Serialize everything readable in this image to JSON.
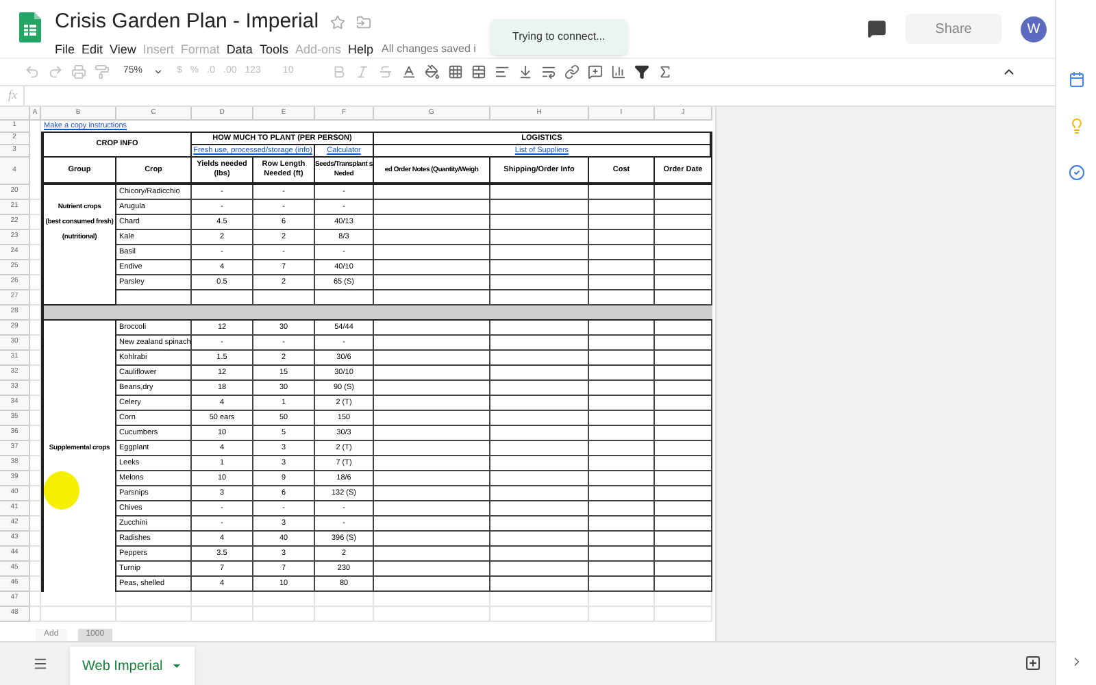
{
  "document": {
    "title": "Crisis Garden Plan - Imperial",
    "starred": false
  },
  "menu": [
    {
      "label": "File",
      "disabled": false
    },
    {
      "label": "Edit",
      "disabled": false
    },
    {
      "label": "View",
      "disabled": false
    },
    {
      "label": "Insert",
      "disabled": true
    },
    {
      "label": "Format",
      "disabled": true
    },
    {
      "label": "Data",
      "disabled": false
    },
    {
      "label": "Tools",
      "disabled": false
    },
    {
      "label": "Add-ons",
      "disabled": true
    },
    {
      "label": "Help",
      "disabled": false
    }
  ],
  "save_status": "All changes saved i",
  "toast": "Trying to connect...",
  "share": {
    "label": "Share",
    "disabled": true
  },
  "avatar": "W",
  "toolbar": {
    "zoom": "75%",
    "currency": "$",
    "percent": "%",
    "decrease_decimal": ".0",
    "increase_decimal": ".00",
    "more_formats": "123",
    "font_size": "10"
  },
  "formula_bar": {
    "label": "fx"
  },
  "columns": [
    "A",
    "B",
    "C",
    "D",
    "E",
    "F",
    "G",
    "H",
    "I",
    "J"
  ],
  "header": {
    "row_numbers": [
      "1",
      "2",
      "3",
      "4"
    ],
    "copy_link": "Make a copy instructions",
    "crop_info": "CROP INFO",
    "how_much": "HOW MUCH TO PLANT (PER PERSON)",
    "logistics": "LOGISTICS",
    "fresh_link": "Fresh use, processed/storage (info)",
    "calculator_link": "Calculator",
    "suppliers_link": "List of Suppliers",
    "column_titles": [
      "Group",
      "Crop",
      "Yields needed (lbs)",
      "Row Length Needed (ft)",
      "Seeds/Transplant s Neded",
      "ed Order Notes (Quantity/Weigh",
      "Shipping/Order Info",
      "Cost",
      "Order Date"
    ]
  },
  "rows": [
    {
      "kind": "crop",
      "number": "20",
      "crop": "Chicory/Radicchio",
      "yields": "-",
      "row_length": "-",
      "seeds": "-"
    },
    {
      "kind": "crop",
      "number": "21",
      "group": "Nutrient crops",
      "crop": "Arugula",
      "yields": "-",
      "row_length": "-",
      "seeds": "-"
    },
    {
      "kind": "crop",
      "number": "22",
      "group": "(best consumed fresh)",
      "crop": "Chard",
      "yields": "4.5",
      "row_length": "6",
      "seeds": "40/13"
    },
    {
      "kind": "crop",
      "number": "23",
      "group": "(nutritional)",
      "crop": "Kale",
      "yields": "2",
      "row_length": "2",
      "seeds": "8/3"
    },
    {
      "kind": "crop",
      "number": "24",
      "crop": "Basil",
      "yields": "-",
      "row_length": "-",
      "seeds": "-"
    },
    {
      "kind": "crop",
      "number": "25",
      "crop": "Endive",
      "yields": "4",
      "row_length": "7",
      "seeds": "40/10"
    },
    {
      "kind": "crop",
      "number": "26",
      "crop": "Parsley",
      "yields": "0.5",
      "row_length": "2",
      "seeds": "65 (S)"
    },
    {
      "kind": "blank",
      "number": "27"
    },
    {
      "kind": "band",
      "number": "28"
    },
    {
      "kind": "crop",
      "number": "29",
      "crop": "Broccoli",
      "yields": "12",
      "row_length": "30",
      "seeds": "54/44"
    },
    {
      "kind": "crop",
      "number": "30",
      "crop": "New zealand spinach",
      "yields": "-",
      "row_length": "-",
      "seeds": "-"
    },
    {
      "kind": "crop",
      "number": "31",
      "crop": "Kohlrabi",
      "yields": "1.5",
      "row_length": "2",
      "seeds": "30/6"
    },
    {
      "kind": "crop",
      "number": "32",
      "crop": "Cauliflower",
      "yields": "12",
      "row_length": "15",
      "seeds": "30/10"
    },
    {
      "kind": "crop",
      "number": "33",
      "crop": "Beans,dry",
      "yields": "18",
      "row_length": "30",
      "seeds": "90 (S)"
    },
    {
      "kind": "crop",
      "number": "34",
      "crop": "Celery",
      "yields": "4",
      "row_length": "1",
      "seeds": "2 (T)"
    },
    {
      "kind": "crop",
      "number": "35",
      "crop": "Corn",
      "yields": "50 ears",
      "row_length": "50",
      "seeds": "150"
    },
    {
      "kind": "crop",
      "number": "36",
      "crop": "Cucumbers",
      "yields": "10",
      "row_length": "5",
      "seeds": "30/3"
    },
    {
      "kind": "crop",
      "number": "37",
      "group": "Supplemental crops",
      "crop": "Eggplant",
      "yields": "4",
      "row_length": "3",
      "seeds": "2 (T)"
    },
    {
      "kind": "crop",
      "number": "38",
      "crop": "Leeks",
      "yields": "1",
      "row_length": "3",
      "seeds": "7 (T)"
    },
    {
      "kind": "crop",
      "number": "39",
      "crop": "Melons",
      "yields": "10",
      "row_length": "9",
      "seeds": "18/6"
    },
    {
      "kind": "crop",
      "number": "40",
      "crop": "Parsnips",
      "yields": "3",
      "row_length": "6",
      "seeds": "132 (S)"
    },
    {
      "kind": "crop",
      "number": "41",
      "crop": "Chives",
      "yields": "-",
      "row_length": "-",
      "seeds": "-"
    },
    {
      "kind": "crop",
      "number": "42",
      "crop": "Zucchini",
      "yields": "-",
      "row_length": "3",
      "seeds": "-"
    },
    {
      "kind": "crop",
      "number": "43",
      "crop": "Radishes",
      "yields": "4",
      "row_length": "40",
      "seeds": "396 (S)"
    },
    {
      "kind": "crop",
      "number": "44",
      "crop": "Peppers",
      "yields": "3.5",
      "row_length": "3",
      "seeds": "2"
    },
    {
      "kind": "crop",
      "number": "45",
      "crop": "Turnip",
      "yields": "7",
      "row_length": "7",
      "seeds": "230"
    },
    {
      "kind": "crop",
      "number": "46",
      "crop": "Peas, shelled",
      "yields": "4",
      "row_length": "10",
      "seeds": "80"
    },
    {
      "kind": "empty",
      "number": "47"
    },
    {
      "kind": "empty",
      "number": "48"
    }
  ],
  "bottom_buttons": [
    "Add",
    "1000"
  ],
  "sheet_tabs": [
    {
      "label": "Web Imperial",
      "selected": true
    }
  ]
}
